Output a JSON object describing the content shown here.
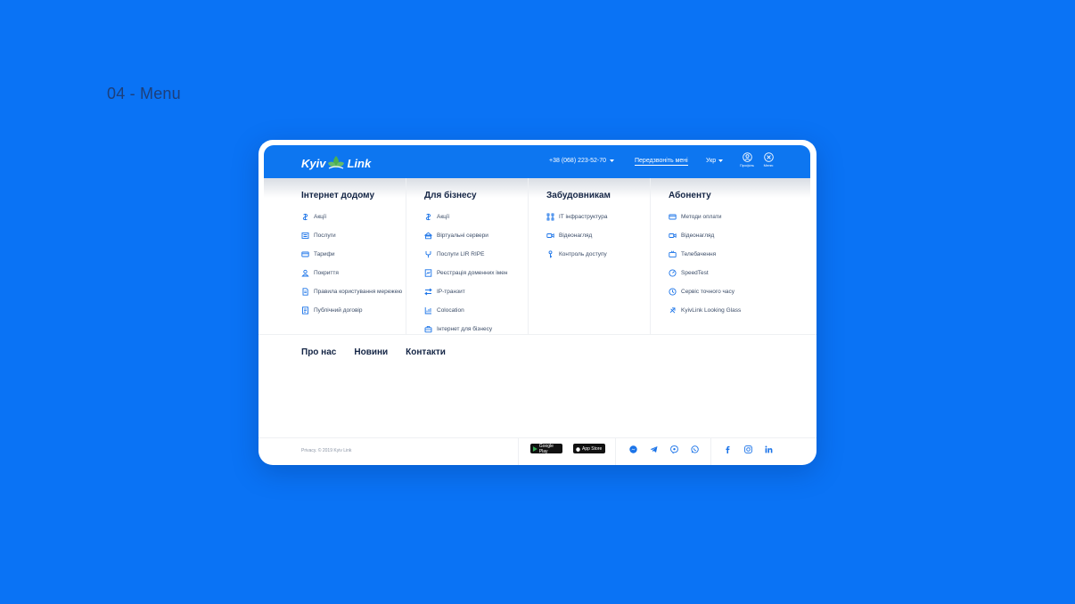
{
  "slide_title": "04 - Menu",
  "header": {
    "logo_left": "Kyiv",
    "logo_right": "Link",
    "phone": "+38 (068) 223-52-70",
    "callback": "Передзвоніть мені",
    "lang": "Укр",
    "profile_label": "Профіль",
    "menu_label": "Меню"
  },
  "columns": [
    {
      "title": "Інтернет додому",
      "items": [
        {
          "label": "Акції",
          "icon": "promo-icon"
        },
        {
          "label": "Послуги",
          "icon": "services-icon"
        },
        {
          "label": "Тарифи",
          "icon": "tariffs-icon"
        },
        {
          "label": "Покриття",
          "icon": "coverage-icon"
        },
        {
          "label": "Правила користування мережею",
          "icon": "rules-icon"
        },
        {
          "label": "Публічний договір",
          "icon": "contract-icon"
        }
      ]
    },
    {
      "title": "Для бізнесу",
      "items": [
        {
          "label": "Акції",
          "icon": "promo-icon"
        },
        {
          "label": "Віртуальні сервери",
          "icon": "servers-icon"
        },
        {
          "label": "Послуги LIR RIPE",
          "icon": "lir-icon"
        },
        {
          "label": "Реєстрація доменних імен",
          "icon": "domain-icon"
        },
        {
          "label": "IP-транзит",
          "icon": "transit-icon"
        },
        {
          "label": "Colocation",
          "icon": "colocation-icon"
        },
        {
          "label": "Інтернет для бізнесу",
          "icon": "business-internet-icon"
        }
      ]
    },
    {
      "title": "Забудовникам",
      "items": [
        {
          "label": "IT інфраструктура",
          "icon": "infrastructure-icon"
        },
        {
          "label": "Відеонагляд",
          "icon": "camera-icon"
        },
        {
          "label": "Контроль доступу",
          "icon": "key-icon"
        }
      ]
    },
    {
      "title": "Абоненту",
      "items": [
        {
          "label": "Методи оплати",
          "icon": "card-icon"
        },
        {
          "label": "Відеонагляд",
          "icon": "camera-icon"
        },
        {
          "label": "Телебачення",
          "icon": "tv-icon"
        },
        {
          "label": "SpeedTest",
          "icon": "speedtest-icon"
        },
        {
          "label": "Сервіс точного часу",
          "icon": "clock-icon"
        },
        {
          "label": "KyivLink Looking Glass",
          "icon": "glass-icon"
        }
      ]
    }
  ],
  "extra_links": [
    "Про нас",
    "Новини",
    "Контакти"
  ],
  "footer": {
    "copyright": "Privacy. © 2019 Kyiv Link",
    "google_play": "Google Play",
    "app_store": "App Store"
  },
  "colors": {
    "background": "#0a73f5",
    "header": "#0d76f0",
    "text_dark": "#142545",
    "accent": "#1a73e8"
  }
}
